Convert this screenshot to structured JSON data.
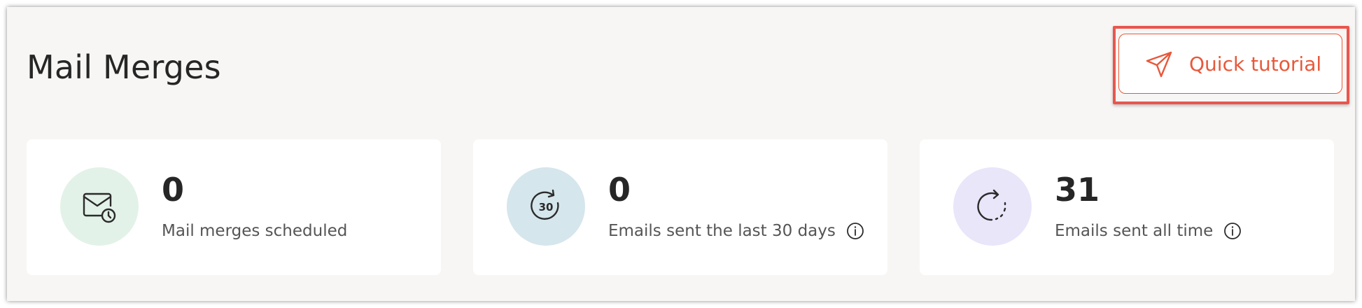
{
  "header": {
    "title": "Mail Merges",
    "tutorial_button": {
      "label": "Quick tutorial",
      "icon": "paper-plane-icon"
    }
  },
  "stats": [
    {
      "value": "0",
      "label": "Mail merges scheduled",
      "icon": "mail-clock-icon",
      "bg": "#e3f2e8",
      "info": false
    },
    {
      "value": "0",
      "label": "Emails sent the last 30 days",
      "icon": "refresh-30-icon",
      "icon_text": "30",
      "bg": "#d5e6ec",
      "info": true
    },
    {
      "value": "31",
      "label": "Emails sent all time",
      "icon": "dashed-refresh-icon",
      "bg": "#e9e6fa",
      "info": true
    }
  ],
  "colors": {
    "accent": "#e8583a",
    "highlight": "#e9564d",
    "background": "#f7f6f4"
  }
}
